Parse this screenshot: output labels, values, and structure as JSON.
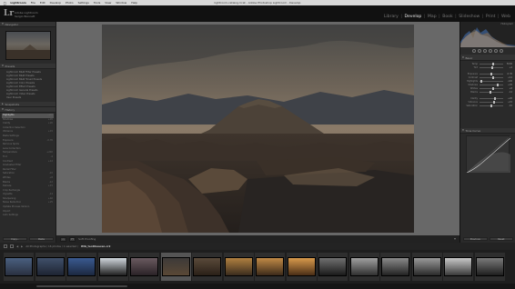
{
  "menubar": {
    "items": [
      "Lightroom",
      "File",
      "Edit",
      "Develop",
      "Photo",
      "Settings",
      "Tools",
      "View",
      "Window",
      "Help"
    ],
    "window_title": "lightroom-catalog.lrcat - Adobe Photoshop Lightroom - Develop"
  },
  "identity": {
    "logo": "Lr",
    "line1": "Adobe Lightroom",
    "line2": "Sergio Bonnett"
  },
  "modules": [
    "Library",
    "Develop",
    "Map",
    "Book",
    "Slideshow",
    "Print",
    "Web"
  ],
  "active_module": "Develop",
  "left_panel": {
    "navigator_label": "Navigator",
    "presets_label": "Presets",
    "presets": [
      "Lightroom B&W Filter Presets",
      "Lightroom B&W Presets",
      "Lightroom B&W Toned Presets",
      "Lightroom Color Presets",
      "Lightroom Effect Presets",
      "Lightroom General Presets",
      "Lightroom Video Presets",
      "User Presets"
    ],
    "snapshots_label": "Snapshots",
    "history_label": "History",
    "history": [
      {
        "name": "Highlights",
        "val": "-100",
        "sel": true
      },
      {
        "name": "Shadows",
        "val": "+45"
      },
      {
        "name": "Clarity",
        "val": "+20"
      },
      {
        "name": "Collection Selection",
        "val": ""
      },
      {
        "name": "Vibrance",
        "val": "+15"
      },
      {
        "name": "Paste Settings",
        "val": ""
      },
      {
        "name": "Exposure",
        "val": "-0.35"
      },
      {
        "name": "Remove Spots",
        "val": ""
      },
      {
        "name": "Lens Correction",
        "val": ""
      },
      {
        "name": "Temperature",
        "val": "+200"
      },
      {
        "name": "Tint",
        "val": "-4"
      },
      {
        "name": "Contrast",
        "val": "+12"
      },
      {
        "name": "Graduated Filter",
        "val": ""
      },
      {
        "name": "Radial Filter",
        "val": ""
      },
      {
        "name": "Saturation",
        "val": "-10"
      },
      {
        "name": "Whites",
        "val": "+8"
      },
      {
        "name": "Blacks",
        "val": "-12"
      },
      {
        "name": "Dehaze",
        "val": "+15"
      },
      {
        "name": "Crop Rectangle",
        "val": ""
      },
      {
        "name": "Vignette",
        "val": "-14"
      },
      {
        "name": "Sharpening",
        "val": "+40"
      },
      {
        "name": "Noise Reduction",
        "val": "+25"
      },
      {
        "name": "Update Process Version",
        "val": ""
      },
      {
        "name": "Import",
        "val": ""
      },
      {
        "name": "Auto Settings",
        "val": ""
      }
    ],
    "copy_label": "Copy...",
    "paste_label": "Paste"
  },
  "toolbar": {
    "soft_proofing": "Soft Proofing"
  },
  "right_panel": {
    "histogram_label": "Histogram",
    "basic_label": "Basic",
    "sliders": [
      {
        "name": "Temp",
        "pos": 0.55,
        "val": "5000"
      },
      {
        "name": "Tint",
        "pos": 0.5,
        "val": "+4"
      },
      {
        "name": "Exposure",
        "pos": 0.45,
        "val": "-0.35"
      },
      {
        "name": "Contrast",
        "pos": 0.55,
        "val": "+12"
      },
      {
        "name": "Highlights",
        "pos": 0.05,
        "val": "-100"
      },
      {
        "name": "Shadows",
        "pos": 0.72,
        "val": "+45"
      },
      {
        "name": "Whites",
        "pos": 0.54,
        "val": "+8"
      },
      {
        "name": "Blacks",
        "pos": 0.44,
        "val": "-12"
      },
      {
        "name": "Clarity",
        "pos": 0.6,
        "val": "+20"
      },
      {
        "name": "Vibrance",
        "pos": 0.58,
        "val": "+15"
      },
      {
        "name": "Saturation",
        "pos": 0.45,
        "val": "-10"
      }
    ],
    "tone_curve_label": "Tone Curve",
    "previous_label": "Previous",
    "reset_label": "Reset"
  },
  "filmstrip": {
    "path": "All Photographs / 16 photos / 1 selected /",
    "filename": "IMG_teotihuacan.cr2",
    "thumbs": [
      {
        "colors": [
          "#4a6080",
          "#2a3040"
        ]
      },
      {
        "colors": [
          "#40506a",
          "#1e2432"
        ]
      },
      {
        "colors": [
          "#3a5a90",
          "#1c2840"
        ]
      },
      {
        "colors": [
          "#d0d6dc",
          "#202020"
        ]
      },
      {
        "colors": [
          "#6a5a60",
          "#2a2226"
        ]
      },
      {
        "colors": [
          "#3d3a38",
          "#5a4836"
        ],
        "sel": true
      },
      {
        "colors": [
          "#5a4a3a",
          "#2a2018"
        ]
      },
      {
        "colors": [
          "#b08040",
          "#3a2c1e"
        ]
      },
      {
        "colors": [
          "#c08a46",
          "#3c2a1a"
        ]
      },
      {
        "colors": [
          "#d89a4c",
          "#4a2e16"
        ]
      },
      {
        "colors": [
          "#707070",
          "#1a1a1a"
        ]
      },
      {
        "colors": [
          "#a0a0a0",
          "#303030"
        ]
      },
      {
        "colors": [
          "#8a8a8a",
          "#222222"
        ]
      },
      {
        "colors": [
          "#9a9a9a",
          "#2a2a2a"
        ]
      },
      {
        "colors": [
          "#c8c8c8",
          "#3a3a3a"
        ]
      },
      {
        "colors": [
          "#7a7a7a",
          "#1e1e1e"
        ]
      }
    ]
  },
  "photo": {
    "sky_top": "#4a4a48",
    "sky_mid": "#8a7a68",
    "pyramid": "#4c4238",
    "mountains": "#3f4248",
    "ground": "#2e2a28"
  }
}
